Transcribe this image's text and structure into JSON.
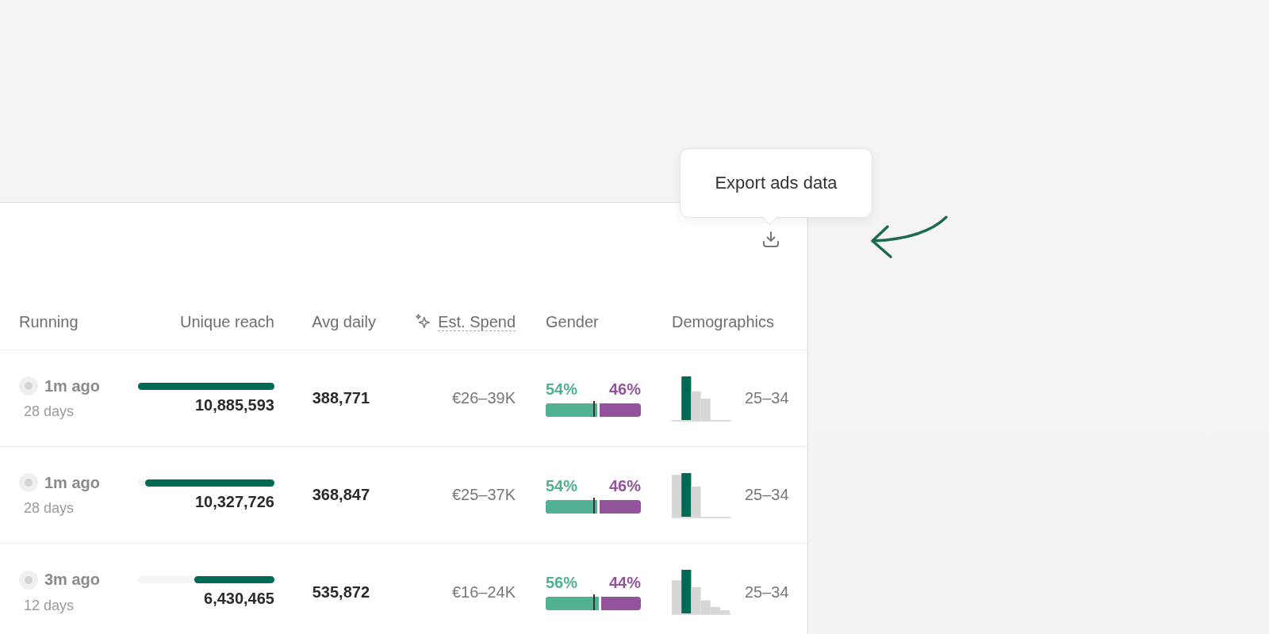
{
  "tooltip": {
    "text": "Export ads data"
  },
  "table": {
    "columns": [
      {
        "label": "Running",
        "kind": "plain"
      },
      {
        "label": "Unique reach",
        "kind": "plain"
      },
      {
        "label": "Avg daily",
        "kind": "plain"
      },
      {
        "label": "Est. Spend",
        "kind": "estimated"
      },
      {
        "label": "Gender",
        "kind": "plain"
      },
      {
        "label": "Demographics",
        "kind": "plain"
      }
    ],
    "rows": [
      {
        "last_seen": "1m ago",
        "duration": "28 days",
        "reach": {
          "value": "10,885,593",
          "level": 1
        },
        "avg_daily": "388,771",
        "spend": "€26–39K",
        "gender": {
          "male": "54%",
          "female": "46%",
          "level": 0.54
        },
        "age": "25–34"
      },
      {
        "last_seen": "1m ago",
        "duration": "28 days",
        "reach": {
          "value": "10,327,726",
          "level": 0.95
        },
        "avg_daily": "368,847",
        "spend": "€25–37K",
        "gender": {
          "male": "54%",
          "female": "46%",
          "level": 0.54
        },
        "age": "25–34"
      },
      {
        "last_seen": "3m ago",
        "duration": "12 days",
        "reach": {
          "value": "6,430,465",
          "level": 0.59
        },
        "avg_daily": "535,872",
        "spend": "€16–24K",
        "gender": {
          "male": "56%",
          "female": "44%",
          "level": 0.56
        },
        "age": "25–34"
      }
    ]
  }
}
